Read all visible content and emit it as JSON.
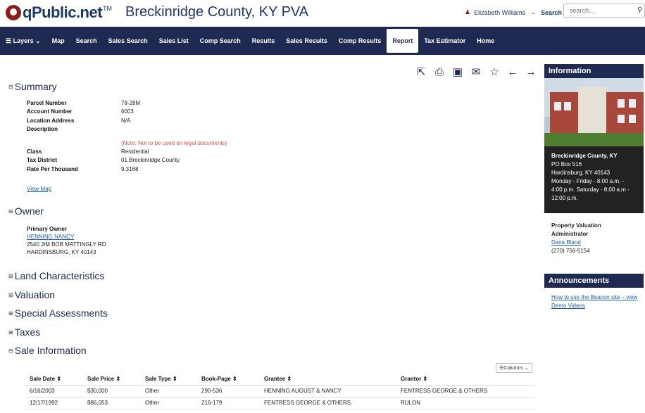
{
  "header": {
    "logo_text": "qPublic.net",
    "logo_tm": "TM",
    "title": "Breckinridge County, KY PVA",
    "user_name": "Elizabeth Williams",
    "search_label": "Search",
    "search_placeholder": "search..."
  },
  "nav": {
    "items": [
      {
        "label": "☰ Layers  ⌄"
      },
      {
        "label": "Map"
      },
      {
        "label": "Search"
      },
      {
        "label": "Sales Search"
      },
      {
        "label": "Sales List"
      },
      {
        "label": "Comp Search"
      },
      {
        "label": "Results"
      },
      {
        "label": "Sales Results"
      },
      {
        "label": "Comp Results"
      },
      {
        "label": "Report"
      },
      {
        "label": "Tax Estimator"
      },
      {
        "label": "Home"
      }
    ],
    "active": "Report"
  },
  "toolbar": {
    "icons": [
      "share-icon",
      "print-icon",
      "image-icon",
      "email-icon",
      "star-icon",
      "arrow-left-icon",
      "arrow-right-icon"
    ]
  },
  "summary": {
    "heading": "Summary",
    "fields": [
      {
        "label": "Parcel Number",
        "value": "78-28M"
      },
      {
        "label": "Account Number",
        "value": "6003"
      },
      {
        "label": "Location Address",
        "value": "N/A"
      },
      {
        "label": "Description",
        "value": ""
      },
      {
        "label": "",
        "value": "(Note: Not to be used on legal documents)"
      },
      {
        "label": "Class",
        "value": "Residential"
      },
      {
        "label": "Tax District",
        "value": "01 Breckinridge County"
      },
      {
        "label": "Rate Per Thousand",
        "value": "9.3168"
      }
    ],
    "view_map": "View Map"
  },
  "owner": {
    "heading": "Owner",
    "label": "Primary Owner",
    "name": "HENNING NANCY",
    "address1": "2540 JIM BOB MATTINGLY RD",
    "address2": "HARDINSBURG, KY 40143"
  },
  "collapsed_sections": [
    "Land Characteristics",
    "Valuation",
    "Special Assessments",
    "Taxes"
  ],
  "sale_info": {
    "heading": "Sale Information",
    "columns_button": "☰Columns ⌄",
    "columns": [
      "Sale Date ⇕",
      "Sale Price ⇕",
      "Sale Type ⇕",
      "Book-Page ⇕",
      "Grantee ⇕",
      "Grantor ⇕"
    ],
    "rows": [
      [
        "6/16/2003",
        "$30,000",
        "Other",
        "290-536",
        "HENNING AUGUST & NANCY",
        "FENTRESS GEORGE & OTHERS"
      ],
      [
        "12/17/1992",
        "$86,053",
        "Other",
        "216-179",
        "FENTRESS GEORGE & OTHERS",
        "RULON"
      ]
    ]
  },
  "sidebar": {
    "info_heading": "Information",
    "office_name": "Breckinridge County, KY",
    "office_lines": [
      "PO Box 516",
      "Hardinsburg, KY 40143",
      "Monday - Friday - 8:00 a.m. -",
      "4:00 p.m. Saturday - 8:00 a.m -",
      "12:00 p.m."
    ],
    "pva_title_1": "Property Valuation",
    "pva_title_2": "Administrator",
    "pva_name": "Dana Bland",
    "pva_phone": "(270) 756-5154",
    "ann_heading": "Announcements",
    "ann_link_1": "How to use the Beacon site – view",
    "ann_link_2": "Demo Videos"
  },
  "colors": {
    "nav_bg": "#1f2a52",
    "brand": "#1b3a6b",
    "logo_red": "#8b1a1a",
    "note_red": "#d9534f",
    "link": "#1a5ea8"
  }
}
